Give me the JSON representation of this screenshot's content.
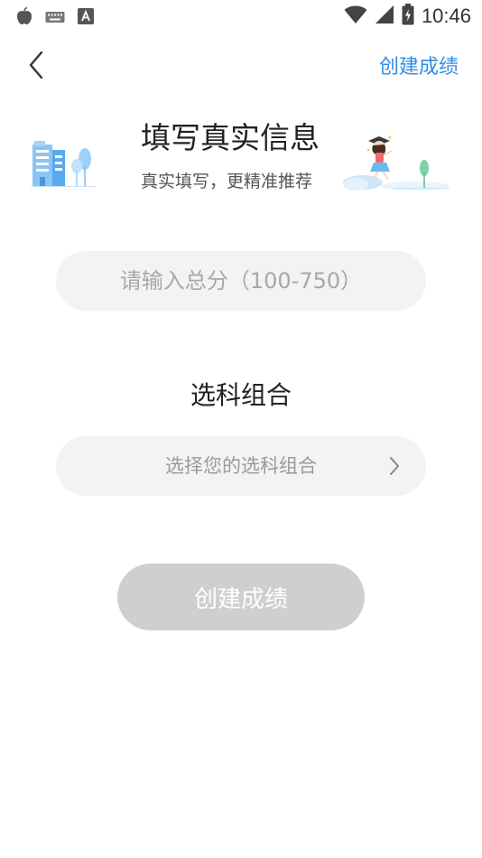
{
  "status_bar": {
    "time": "10:46",
    "icons": [
      "apple-app-icon",
      "keyboard-icon",
      "font-a-icon",
      "wifi-icon",
      "signal-icon",
      "battery-charging-icon"
    ]
  },
  "header": {
    "back_icon": "chevron-left-icon",
    "action_label": "创建成绩",
    "accent_color": "#2f8de6"
  },
  "banner": {
    "title": "填写真实信息",
    "subtitle": "真实填写，更精准推荐"
  },
  "form": {
    "score_placeholder": "请输入总分（100-750）",
    "score_value": "",
    "subjects_title": "选科组合",
    "subjects_placeholder": "选择您的选科组合",
    "submit_label": "创建成绩",
    "submit_disabled_color": "#cfcfcf"
  }
}
